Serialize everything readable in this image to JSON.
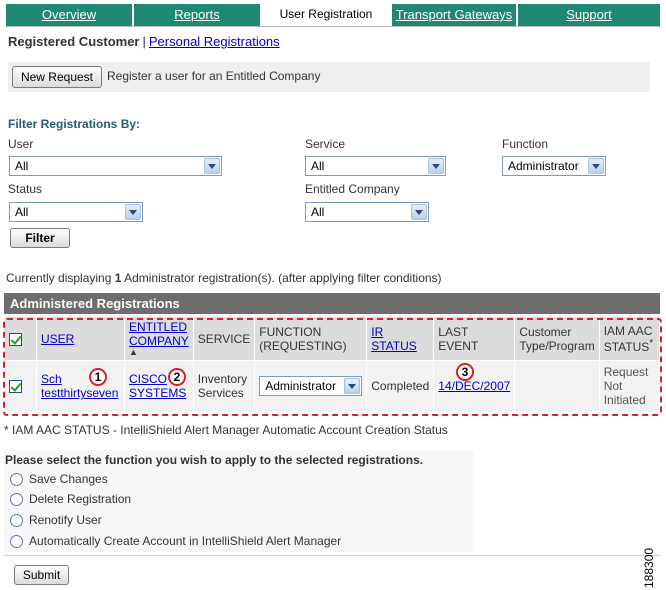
{
  "tabs": [
    "Overview",
    "Reports",
    "User Registration",
    "Transport Gateways",
    "Support"
  ],
  "active_tab": "User Registration",
  "subnav": {
    "current": "Registered Customer",
    "separator": "|",
    "link": "Personal Registrations"
  },
  "new_request": {
    "button": "New Request",
    "text": "Register a user for an Entitled Company"
  },
  "filter": {
    "title": "Filter Registrations By:",
    "user_label": "User",
    "user_value": "All",
    "service_label": "Service",
    "service_value": "All",
    "function_label": "Function",
    "function_value": "Administrator",
    "status_label": "Status",
    "status_value": "All",
    "company_label": "Entitled Company",
    "company_value": "All",
    "button": "Filter"
  },
  "display": {
    "prefix": "Currently displaying ",
    "count": "1",
    "suffix": " Administrator registration(s). (after applying filter conditions)"
  },
  "section_title": "Administered Registrations",
  "table": {
    "headers": {
      "user": "USER",
      "company": "ENTITLED COMPANY",
      "service": "SERVICE",
      "function": "FUNCTION (REQUESTING)",
      "ir_status": "IR STATUS",
      "last_event": "LAST EVENT",
      "customer_type": "Customer Type/Program",
      "iam": "IAM AAC STATUS",
      "iam_mark": "*"
    },
    "sort_indicator": "▲",
    "row": {
      "user": "Sch testthirtyseven",
      "company": "CISCO SYSTEMS",
      "service": "Inventory Services",
      "function": "Administrator",
      "ir_status": "Completed",
      "last_event": "14/DEC/2007",
      "customer_type": "",
      "iam": "Request Not Initiated"
    },
    "callouts": [
      "1",
      "2",
      "3"
    ]
  },
  "footnote": "* IAM AAC STATUS - IntelliShield Alert Manager Automatic Account Creation Status",
  "functions": {
    "title": "Please select the function you wish to apply to the selected registrations.",
    "options": [
      "Save Changes",
      "Delete Registration",
      "Renotify User",
      "Automatically Create Account in IntelliShield Alert Manager"
    ],
    "submit": "Submit"
  },
  "figure_number": "188300",
  "colors": {
    "tab_bg": "#1f8872",
    "section_bar": "#6d6d6d",
    "callout_red": "#d5202a",
    "link": "#0000cc"
  }
}
